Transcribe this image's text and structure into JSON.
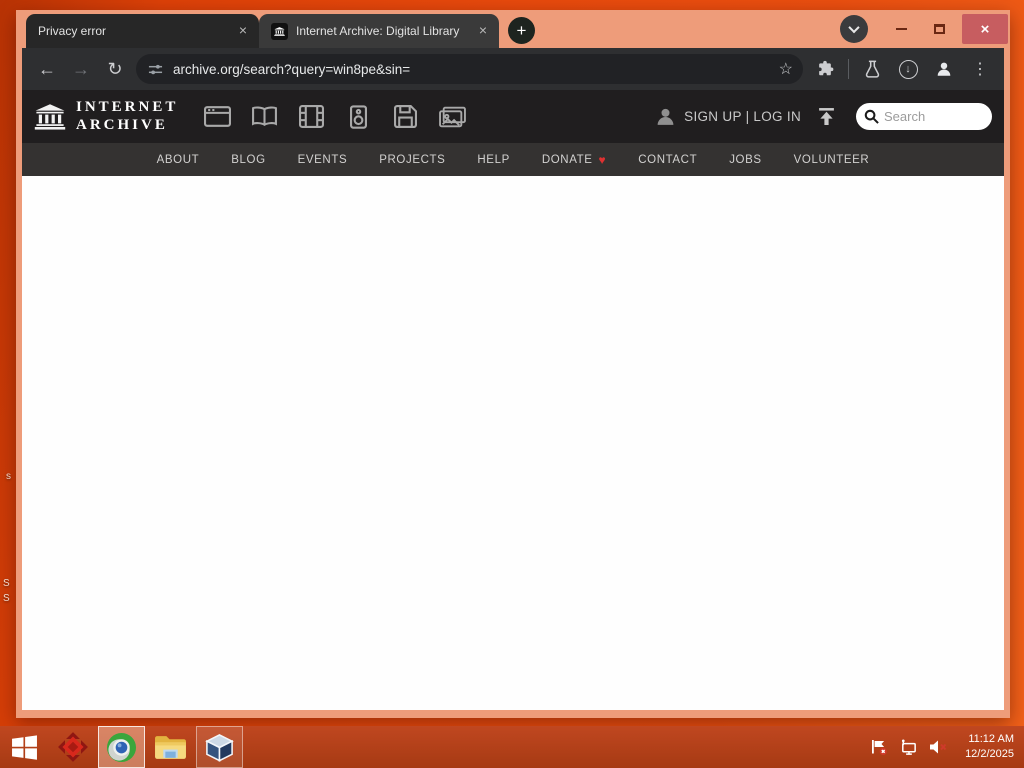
{
  "browser": {
    "tabs": [
      {
        "title": "Privacy error",
        "active": false
      },
      {
        "title": "Internet Archive: Digital Library",
        "active": true
      }
    ],
    "close_glyph": "×",
    "new_tab_glyph": "+",
    "toolbar": {
      "back_glyph": "←",
      "forward_glyph": "→",
      "reload_glyph": "↻",
      "star_glyph": "☆",
      "download_glyph": "↓",
      "menu_glyph": "⋮",
      "url": "archive.org/search?query=win8pe&sin="
    }
  },
  "archive": {
    "logo_line1": "INTERNET",
    "logo_line2": "ARCHIVE",
    "auth": "SIGN UP | LOG IN",
    "search_placeholder": "Search",
    "media_types": [
      "web",
      "texts",
      "video",
      "audio",
      "software",
      "images"
    ],
    "nav": [
      "ABOUT",
      "BLOG",
      "EVENTS",
      "PROJECTS",
      "HELP",
      "DONATE",
      "CONTACT",
      "JOBS",
      "VOLUNTEER"
    ],
    "donate_heart": "♥"
  },
  "desktop": {
    "partial_icon_labels": [
      "s",
      "S",
      "S"
    ]
  },
  "taskbar": {
    "time": "11:12 AM",
    "date": "12/2/2025"
  },
  "colors": {
    "desktop_red": "#e8490d",
    "frame_salmon": "#ee9c7a",
    "taskbar_red": "#b03e16",
    "header_dark": "#201e1f",
    "nav_dark": "#343231",
    "close_button_red": "#c75d60",
    "heart_red": "#e03131"
  }
}
